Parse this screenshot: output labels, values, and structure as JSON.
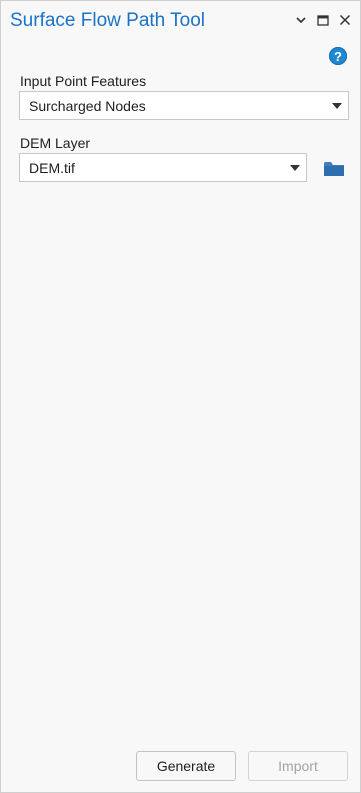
{
  "pane": {
    "title": "Surface Flow Path Tool",
    "controls": [
      "chevron-down-icon",
      "maximize-icon",
      "close-icon"
    ],
    "help_icon": "help-icon"
  },
  "fields": {
    "input_points": {
      "label": "Input Point Features",
      "value": "Surcharged Nodes"
    },
    "dem_layer": {
      "label": "DEM Layer",
      "value": "DEM.tif",
      "browse_icon": "folder-icon"
    }
  },
  "buttons": {
    "generate": "Generate",
    "import": "Import",
    "import_enabled": false
  },
  "colors": {
    "accent": "#1a73c9",
    "background": "#f8f8f8",
    "help": "#1e88d2",
    "folder": "#3d7fbf",
    "disabled_text": "#a3a3a3"
  }
}
